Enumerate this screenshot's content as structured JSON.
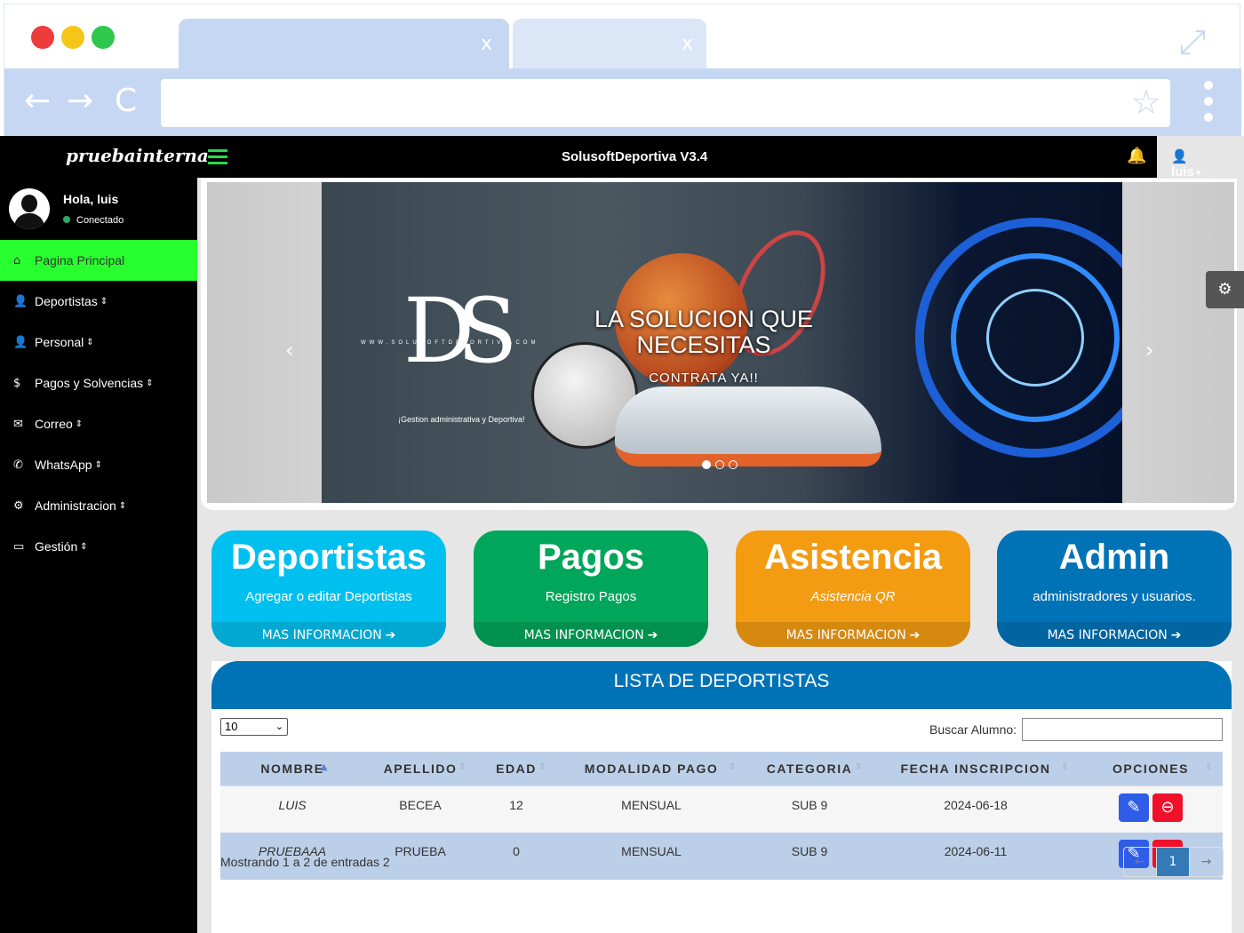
{
  "browser": {
    "tab_close": "x",
    "back": "←",
    "forward": "→",
    "reload": "C",
    "star": "☆",
    "expand": "⤢"
  },
  "app": {
    "brand": "pruebainterna",
    "title": "SolusoftDeportiva V3.4",
    "user": "luis",
    "user_caret": "▾"
  },
  "sidebar": {
    "greeting": "Hola, luis",
    "status": "Conectado",
    "items": [
      {
        "label": "Pagina Principal",
        "icon": "home-icon",
        "glyph": "⌂",
        "active": true
      },
      {
        "label": "Deportistas",
        "icon": "user-icon",
        "glyph": "👤"
      },
      {
        "label": "Personal",
        "icon": "user-icon",
        "glyph": "👤"
      },
      {
        "label": "Pagos y Solvencias",
        "icon": "dollar-icon",
        "glyph": "$"
      },
      {
        "label": "Correo",
        "icon": "envelope-icon",
        "glyph": "✉"
      },
      {
        "label": "WhatsApp",
        "icon": "whatsapp-icon",
        "glyph": "✆"
      },
      {
        "label": "Administracion",
        "icon": "cogs-icon",
        "glyph": "⚙"
      },
      {
        "label": "Gestión",
        "icon": "folder-open-icon",
        "glyph": "▭"
      }
    ]
  },
  "carousel": {
    "logo_url": "WWW.SOLUSOFTDEPORTIVA.COM",
    "logo_letters": "DS",
    "logo_tagline": "¡Gestion administrativa y Deportiva!",
    "caption_title": "LA SOLUCION QUE NECESITAS",
    "caption_sub": "CONTRATA YA!!",
    "slides": 3,
    "active_slide": 1,
    "prev": "‹",
    "next": "›"
  },
  "boxes": [
    {
      "title": "Deportistas",
      "subtitle": "Agregar o editar Deportistas",
      "more": "MAS INFORMACION",
      "color": "#00c0ef",
      "italic": false
    },
    {
      "title": "Pagos",
      "subtitle": "Registro Pagos",
      "more": "MAS INFORMACION",
      "color": "#00a65a",
      "italic": false
    },
    {
      "title": "Asistencia",
      "subtitle": "Asistencia QR",
      "more": "MAS INFORMACION",
      "color": "#f39c12",
      "italic": true
    },
    {
      "title": "Admin",
      "subtitle": "administradores y usuarios.",
      "more": "MAS INFORMACION",
      "color": "#0073b7",
      "italic": false
    }
  ],
  "list": {
    "title": "LISTA DE DEPORTISTAS",
    "page_length": "10",
    "search_label": "Buscar Alumno:",
    "search_value": "",
    "columns": [
      "NOMBRE",
      "APELLIDO",
      "EDAD",
      "MODALIDAD PAGO",
      "CATEGORIA",
      "FECHA INSCRIPCION",
      "OPCIONES"
    ],
    "rows": [
      {
        "nombre": "LUIS",
        "apellido": "BECEA",
        "edad": "12",
        "modalidad": "MENSUAL",
        "categoria": "SUB 9",
        "fecha": "2024-06-18"
      },
      {
        "nombre": "PRUEBAAA",
        "apellido": "PRUEBA",
        "edad": "0",
        "modalidad": "MENSUAL",
        "categoria": "SUB 9",
        "fecha": "2024-06-11"
      }
    ],
    "info": "Mostrando 1 a 2 de entradas 2",
    "pager": {
      "prev": "←",
      "current": "1",
      "next": "→"
    }
  },
  "colors": {
    "sidebar_active": "#28ff2e",
    "accent_blue": "#0073b7",
    "edit": "#2f5de8",
    "delete": "#f0102a"
  }
}
